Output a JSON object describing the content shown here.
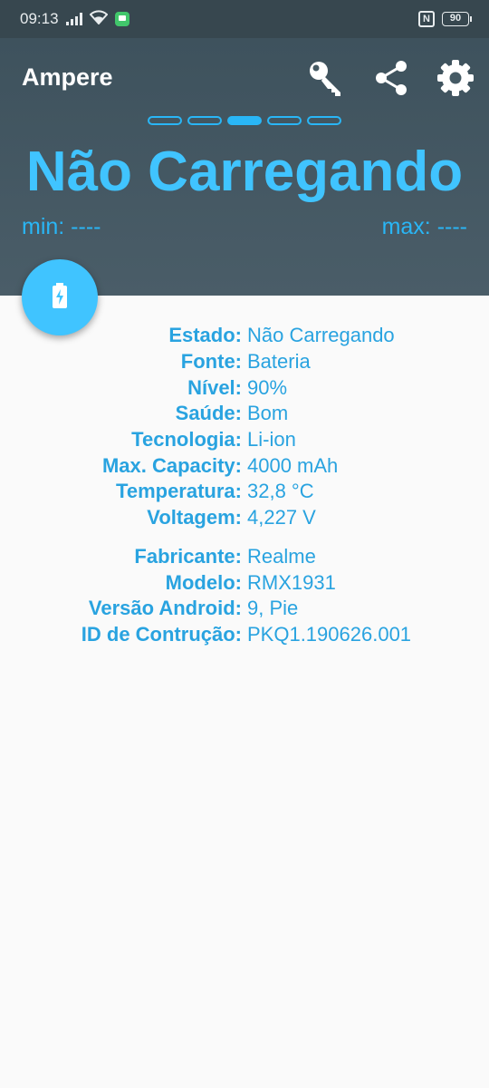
{
  "status_bar": {
    "time": "09:13",
    "battery_level": "90"
  },
  "app": {
    "title": "Ampere"
  },
  "toolbar": {
    "icons": [
      "key-icon",
      "share-icon",
      "gear-icon"
    ]
  },
  "pager": {
    "count": 5,
    "active_index": 2
  },
  "charging_status": "Não Carregando",
  "min_label": "min: ----",
  "max_label": "max: ----",
  "battery_info": [
    {
      "label": "Estado:",
      "value": "Não Carregando"
    },
    {
      "label": "Fonte:",
      "value": "Bateria"
    },
    {
      "label": "Nível:",
      "value": "90%"
    },
    {
      "label": "Saúde:",
      "value": "Bom"
    },
    {
      "label": "Tecnologia:",
      "value": "Li-ion"
    },
    {
      "label": "Max. Capacity:",
      "value": "4000 mAh"
    },
    {
      "label": "Temperatura:",
      "value": "32,8 °C"
    },
    {
      "label": "Voltagem:",
      "value": "4,227 V"
    }
  ],
  "device_info": [
    {
      "label": "Fabricante:",
      "value": "Realme"
    },
    {
      "label": "Modelo:",
      "value": "RMX1931"
    },
    {
      "label": "Versão Android:",
      "value": "9, Pie"
    },
    {
      "label": "ID de Contrução:",
      "value": "PKQ1.190626.001"
    }
  ],
  "colors": {
    "accent": "#40c4ff",
    "text_accent": "#29a3e0",
    "header_bg": "#455a64",
    "statusbar_bg": "#37474f"
  }
}
